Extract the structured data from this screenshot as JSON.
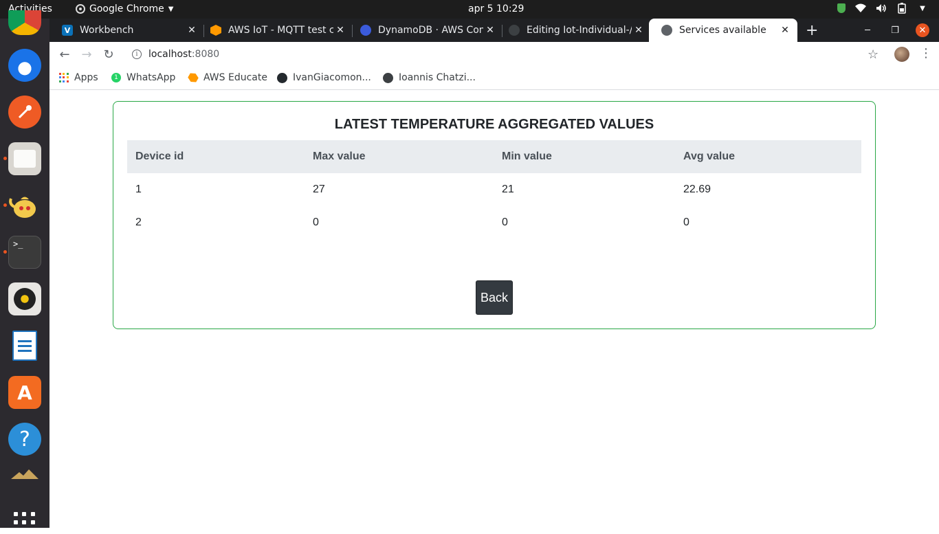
{
  "topbar": {
    "activities": "Activities",
    "app_name": "Google Chrome",
    "clock": "apr 5  10:29"
  },
  "dock": {
    "apps": [
      "chrome-icon",
      "thunderbird-icon",
      "postman-icon",
      "files-icon",
      "teapot-icon",
      "terminal-icon",
      "rhythmbox-icon",
      "writer-icon",
      "software-icon",
      "help-icon",
      "mountain-icon"
    ]
  },
  "tabs": [
    {
      "title": "Workbench",
      "favicon": "V",
      "favicon_color": "#0b72b9"
    },
    {
      "title": "AWS IoT - MQTT test cl",
      "favicon": "",
      "favicon_color": "#ff9900"
    },
    {
      "title": "DynamoDB · AWS Con",
      "favicon": "",
      "favicon_color": "#3b5bdb"
    },
    {
      "title": "Editing Iot-Individual-/",
      "favicon": "",
      "favicon_color": "#24292e"
    },
    {
      "title": "Services available",
      "favicon": "",
      "favicon_color": "#5f6368"
    }
  ],
  "address_bar": {
    "host": "localhost",
    "port": ":8080"
  },
  "bookmarks": [
    {
      "label": "Apps"
    },
    {
      "label": "WhatsApp",
      "badge": "1"
    },
    {
      "label": "AWS Educate"
    },
    {
      "label": "IvanGiacomon..."
    },
    {
      "label": "Ioannis Chatzi..."
    }
  ],
  "page": {
    "heading": "LATEST TEMPERATURE AGGREGATED VALUES",
    "columns": [
      "Device id",
      "Max value",
      "Min value",
      "Avg value"
    ],
    "rows": [
      [
        "1",
        "27",
        "21",
        "22.69"
      ],
      [
        "2",
        "0",
        "0",
        "0"
      ]
    ],
    "back_label": "Back"
  }
}
